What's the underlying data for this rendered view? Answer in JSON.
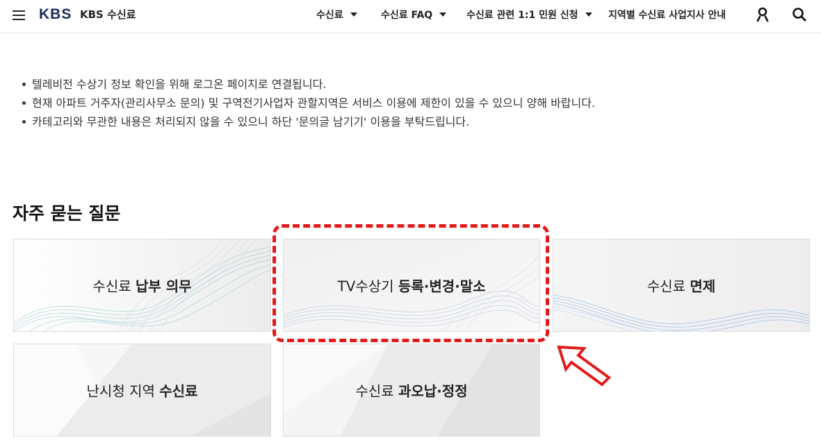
{
  "header": {
    "logo": "KBS",
    "service_name": "KBS 수신료",
    "nav": [
      {
        "label": "수신료",
        "has_dropdown": true
      },
      {
        "label": "수신료 FAQ",
        "has_dropdown": true
      },
      {
        "label": "수신료 관련 1:1 민원 신청",
        "has_dropdown": true
      },
      {
        "label": "지역별 수신료 사업지사 안내",
        "has_dropdown": false
      }
    ],
    "icons": [
      "menu-icon",
      "user-icon",
      "search-icon"
    ]
  },
  "notices": [
    "텔레비전 수상기 정보 확인을 위해 로그온 페이지로 연결됩니다.",
    "현재 아파트 거주자(관리사무소 문의) 및 구역전기사업자 관할지역은 서비스 이용에 제한이 있을 수 있으니 양해 바랍니다.",
    "카테고리와 무관한 내용은 처리되지 않을 수 있으니 하단 '문의글 남기기' 이용을 부탁드립니다."
  ],
  "faq": {
    "title": "자주 묻는 질문",
    "cards": [
      {
        "normal": "수신료 ",
        "bold": "납부 의무"
      },
      {
        "normal": "TV수상기 ",
        "bold": "등록·변경·말소"
      },
      {
        "normal": "수신료 ",
        "bold": "면제"
      },
      {
        "normal": "난시청 지역 ",
        "bold": "수신료"
      },
      {
        "normal": "수신료 ",
        "bold": "과오납·정정"
      }
    ]
  },
  "annotation": {
    "highlight_color": "#e21a1a",
    "highlighted_card_index": 1
  }
}
